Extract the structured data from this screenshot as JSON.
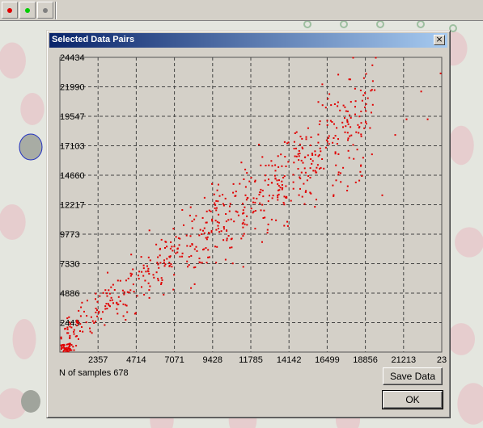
{
  "window": {
    "title": "Selected Data Pairs",
    "close_label": "×"
  },
  "toolbar": {
    "icons": [
      "red-dot-icon",
      "green-dot-icon",
      "gray-dot-icon"
    ],
    "colors": [
      "#e00000",
      "#00cc00",
      "#808080"
    ]
  },
  "footer": {
    "samples_text": "N of samples 678",
    "save_label": "Save Data",
    "ok_label": "OK"
  },
  "chart_data": {
    "type": "scatter",
    "title": "",
    "xlabel": "",
    "ylabel": "",
    "point_color": "#e00000",
    "grid": true,
    "grid_style": "dashed",
    "xlim": [
      0,
      23570
    ],
    "ylim": [
      0,
      24434
    ],
    "x_ticks": [
      "2357",
      "4714",
      "7071",
      "9428",
      "11785",
      "14142",
      "16499",
      "18856",
      "21213",
      "23"
    ],
    "y_ticks": [
      "24434",
      "21990",
      "19547",
      "17103",
      "14660",
      "12217",
      "9773",
      "7330",
      "4886",
      "2443"
    ],
    "n_points": 678,
    "distribution": {
      "trend_slope": 0.98,
      "intercept": 1000,
      "noise_sd": 1800,
      "x_range": [
        0,
        19500
      ]
    },
    "highlight_points": [
      {
        "x": 22300,
        "y": 21600
      },
      {
        "x": 23500,
        "y": 23100
      },
      {
        "x": 19500,
        "y": 24400
      },
      {
        "x": 18100,
        "y": 24400
      },
      {
        "x": 16200,
        "y": 22200
      },
      {
        "x": 21400,
        "y": 19300
      },
      {
        "x": 22700,
        "y": 19300
      },
      {
        "x": 20700,
        "y": 18000
      },
      {
        "x": 19900,
        "y": 13000
      },
      {
        "x": 18600,
        "y": 19000
      }
    ]
  }
}
